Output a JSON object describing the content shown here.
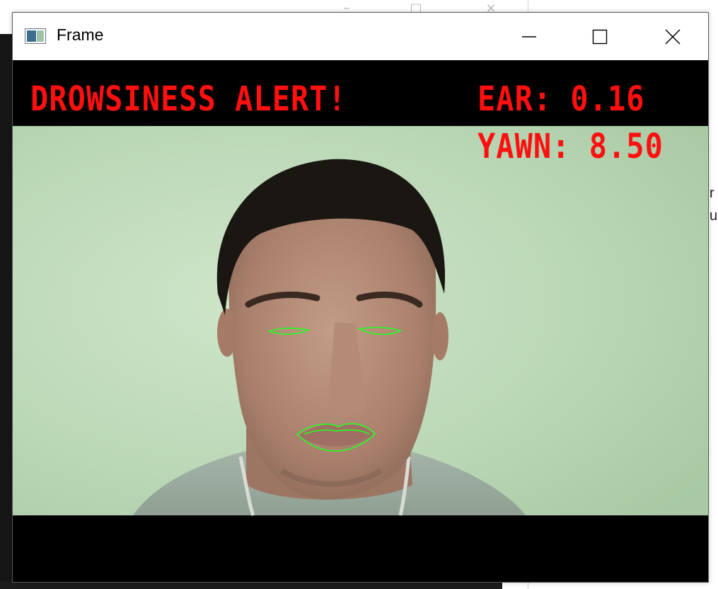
{
  "window": {
    "title": "Frame",
    "controls": {
      "minimize": "minimize-icon",
      "maximize": "maximize-icon",
      "close": "close-icon"
    }
  },
  "overlay": {
    "alert": "DROWSINESS ALERT!",
    "ear": "EAR: 0.16",
    "yawn": "YAWN: 8.50",
    "text_color": "#ff1010",
    "contour_color": "#22ff22"
  },
  "background": {
    "right_fragment_1": "r",
    "right_fragment_2": "ul"
  }
}
